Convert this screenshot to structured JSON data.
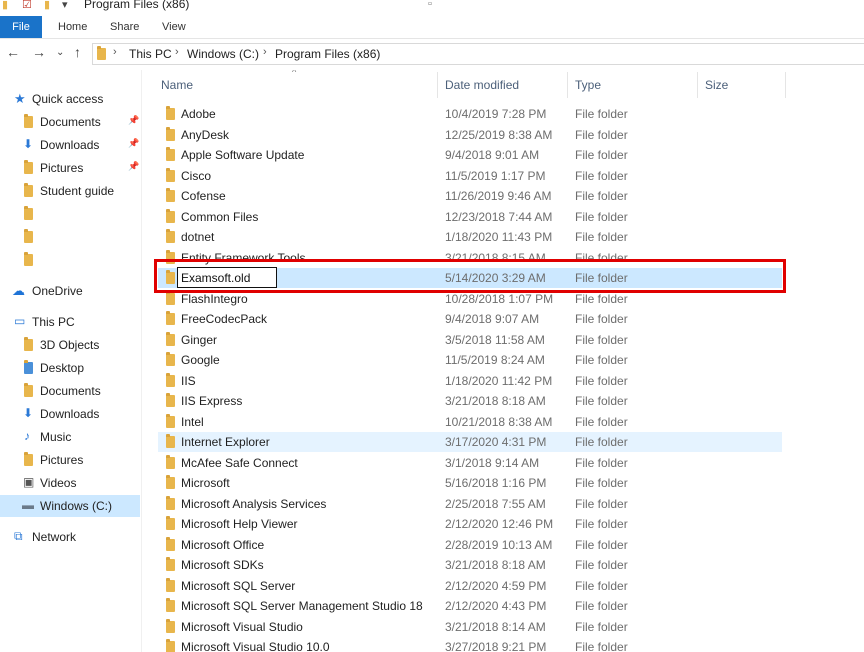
{
  "window": {
    "title": "Program Files (x86)"
  },
  "ribbon": {
    "tabs": [
      "File",
      "Home",
      "Share",
      "View"
    ]
  },
  "address": {
    "crumbs": [
      "This PC",
      "Windows (C:)",
      "Program Files (x86)"
    ]
  },
  "sidebar": {
    "quick_access": "Quick access",
    "quick_items": [
      "Documents",
      "Downloads",
      "Pictures",
      "Student guide"
    ],
    "onedrive": "OneDrive",
    "this_pc": "This PC",
    "pc_items": [
      "3D Objects",
      "Desktop",
      "Documents",
      "Downloads",
      "Music",
      "Pictures",
      "Videos",
      "Windows (C:)"
    ],
    "network": "Network"
  },
  "columns": {
    "name": "Name",
    "date": "Date modified",
    "type": "Type",
    "size": "Size"
  },
  "rename_value": "Examsoft.old",
  "files": [
    {
      "name": "Adobe",
      "date": "10/4/2019 7:28 PM",
      "type": "File folder"
    },
    {
      "name": "AnyDesk",
      "date": "12/25/2019 8:38 AM",
      "type": "File folder"
    },
    {
      "name": "Apple Software Update",
      "date": "9/4/2018 9:01 AM",
      "type": "File folder"
    },
    {
      "name": "Cisco",
      "date": "11/5/2019 1:17 PM",
      "type": "File folder"
    },
    {
      "name": "Cofense",
      "date": "11/26/2019 9:46 AM",
      "type": "File folder"
    },
    {
      "name": "Common Files",
      "date": "12/23/2018 7:44 AM",
      "type": "File folder"
    },
    {
      "name": "dotnet",
      "date": "1/18/2020 11:43 PM",
      "type": "File folder"
    },
    {
      "name": "Entity Framework Tools",
      "date": "3/21/2018 8:15 AM",
      "type": "File folder"
    },
    {
      "name": "Examsoft.old",
      "date": "5/14/2020 3:29 AM",
      "type": "File folder"
    },
    {
      "name": "FlashIntegro",
      "date": "10/28/2018 1:07 PM",
      "type": "File folder"
    },
    {
      "name": "FreeCodecPack",
      "date": "9/4/2018 9:07 AM",
      "type": "File folder"
    },
    {
      "name": "Ginger",
      "date": "3/5/2018 11:58 AM",
      "type": "File folder"
    },
    {
      "name": "Google",
      "date": "11/5/2019 8:24 AM",
      "type": "File folder"
    },
    {
      "name": "IIS",
      "date": "1/18/2020 11:42 PM",
      "type": "File folder"
    },
    {
      "name": "IIS Express",
      "date": "3/21/2018 8:18 AM",
      "type": "File folder"
    },
    {
      "name": "Intel",
      "date": "10/21/2018 8:38 AM",
      "type": "File folder"
    },
    {
      "name": "Internet Explorer",
      "date": "3/17/2020 4:31 PM",
      "type": "File folder"
    },
    {
      "name": "McAfee Safe Connect",
      "date": "3/1/2018 9:14 AM",
      "type": "File folder"
    },
    {
      "name": "Microsoft",
      "date": "5/16/2018 1:16 PM",
      "type": "File folder"
    },
    {
      "name": "Microsoft Analysis Services",
      "date": "2/25/2018 7:55 AM",
      "type": "File folder"
    },
    {
      "name": "Microsoft Help Viewer",
      "date": "2/12/2020 12:46 PM",
      "type": "File folder"
    },
    {
      "name": "Microsoft Office",
      "date": "2/28/2019 10:13 AM",
      "type": "File folder"
    },
    {
      "name": "Microsoft SDKs",
      "date": "3/21/2018 8:18 AM",
      "type": "File folder"
    },
    {
      "name": "Microsoft SQL Server",
      "date": "2/12/2020 4:59 PM",
      "type": "File folder"
    },
    {
      "name": "Microsoft SQL Server Management Studio 18",
      "date": "2/12/2020 4:43 PM",
      "type": "File folder"
    },
    {
      "name": "Microsoft Visual Studio",
      "date": "3/21/2018 8:14 AM",
      "type": "File folder"
    },
    {
      "name": "Microsoft Visual Studio 10.0",
      "date": "3/27/2018 9:21 PM",
      "type": "File folder"
    }
  ]
}
